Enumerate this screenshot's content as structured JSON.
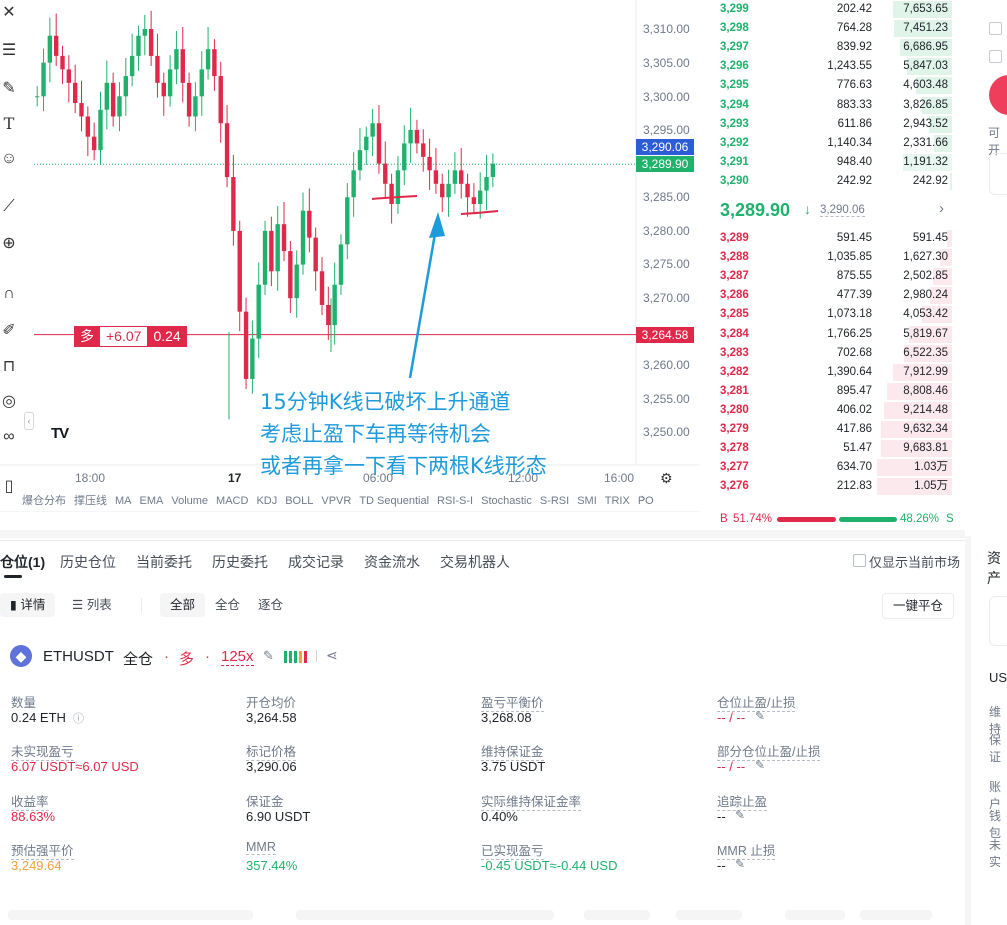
{
  "colors": {
    "up": "#20b26c",
    "down": "#e0294a",
    "annotation": "#1f9bdc",
    "price_blue": "#2c5cd6",
    "orange": "#f0a23b"
  },
  "toolbar_icons": [
    "crosshair-icon",
    "line-tool-icon",
    "brush-icon",
    "text-icon",
    "emoji-icon",
    "ruler-icon",
    "zoom-in-icon",
    "magnet-icon",
    "lock-edit-icon",
    "lock-icon",
    "eye-icon",
    "link-icon",
    "trash-icon"
  ],
  "chart": {
    "y_ticks": [
      "3,310.00",
      "3,305.00",
      "3,300.00",
      "3,295.00",
      "3,285.00",
      "3,280.00",
      "3,275.00",
      "3,270.00",
      "3,260.00",
      "3,255.00",
      "3,250.00"
    ],
    "x_ticks": [
      "18:00",
      "17",
      "06:00",
      "12:00",
      "16:00"
    ],
    "price_marks": {
      "mark": "3,290.06",
      "last": "3,289.90",
      "entry": "3,264.58"
    },
    "position_tag": {
      "side": "多",
      "pnl": "+6.07",
      "qty": "0.24"
    },
    "logo": "TV",
    "annotation": [
      "15分钟K线已破坏上升通道",
      "考虑止盈下车再等待机会",
      "或者再拿一下看下两根K线形态"
    ],
    "indicators": [
      "爆仓分布",
      "撑压线",
      "MA",
      "EMA",
      "Volume",
      "MACD",
      "KDJ",
      "BOLL",
      "VPVR",
      "TD Sequential",
      "RSI-S-I",
      "Stochastic",
      "S-RSI",
      "SMI",
      "TRIX",
      "PO"
    ]
  },
  "orderbook": {
    "bids": [
      {
        "price": "3,299",
        "qty": "202.42",
        "total": "7,653.65",
        "depth": 0.79
      },
      {
        "price": "3,298",
        "qty": "764.28",
        "total": "7,451.23",
        "depth": 0.77
      },
      {
        "price": "3,297",
        "qty": "839.92",
        "total": "6,686.95",
        "depth": 0.69
      },
      {
        "price": "3,296",
        "qty": "1,243.55",
        "total": "5,847.03",
        "depth": 0.6
      },
      {
        "price": "3,295",
        "qty": "776.63",
        "total": "4,603.48",
        "depth": 0.48
      },
      {
        "price": "3,294",
        "qty": "883.33",
        "total": "3,826.85",
        "depth": 0.4
      },
      {
        "price": "3,293",
        "qty": "611.86",
        "total": "2,943.52",
        "depth": 0.3
      },
      {
        "price": "3,292",
        "qty": "1,140.34",
        "total": "2,331.66",
        "depth": 0.24
      },
      {
        "price": "3,291",
        "qty": "948.40",
        "total": "1,191.32",
        "depth": 0.65
      },
      {
        "price": "3,290",
        "qty": "242.92",
        "total": "242.92",
        "depth": 0.03
      }
    ],
    "mid_price": "3,289.90",
    "mid_arrow": "↓",
    "mark_price": "3,290.06",
    "asks": [
      {
        "price": "3,289",
        "qty": "591.45",
        "total": "591.45",
        "depth": 0.06
      },
      {
        "price": "3,288",
        "qty": "1,035.85",
        "total": "1,627.30",
        "depth": 0.16
      },
      {
        "price": "3,287",
        "qty": "875.55",
        "total": "2,502.85",
        "depth": 0.25
      },
      {
        "price": "3,286",
        "qty": "477.39",
        "total": "2,980.24",
        "depth": 0.29
      },
      {
        "price": "3,285",
        "qty": "1,073.18",
        "total": "4,053.42",
        "depth": 0.4
      },
      {
        "price": "3,284",
        "qty": "1,766.25",
        "total": "5,819.67",
        "depth": 0.57
      },
      {
        "price": "3,283",
        "qty": "702.68",
        "total": "6,522.35",
        "depth": 0.64
      },
      {
        "price": "3,282",
        "qty": "1,390.64",
        "total": "7,912.99",
        "depth": 0.78
      },
      {
        "price": "3,281",
        "qty": "895.47",
        "total": "8,808.46",
        "depth": 0.86
      },
      {
        "price": "3,280",
        "qty": "406.02",
        "total": "9,214.48",
        "depth": 0.9
      },
      {
        "price": "3,279",
        "qty": "417.86",
        "total": "9,632.34",
        "depth": 0.94
      },
      {
        "price": "3,278",
        "qty": "51.47",
        "total": "9,683.81",
        "depth": 0.95
      },
      {
        "price": "3,277",
        "qty": "634.70",
        "total": "1.03万",
        "depth": 1.0
      },
      {
        "price": "3,276",
        "qty": "212.83",
        "total": "1.05万",
        "depth": 1.0
      }
    ],
    "ratio": {
      "b_label": "B",
      "b_pct": "51.74%",
      "s_pct": "48.26%",
      "s_label": "S",
      "b_value": 51.74
    }
  },
  "right_cut": {
    "t1": "可开",
    "t2": "资产",
    "t3": "US",
    "t4": "维持",
    "t5": "保证",
    "t6": "账户",
    "t7": "钱包",
    "t8": "未实"
  },
  "tabs": {
    "positions": "仓位(1)",
    "history_positions": "历史仓位",
    "open_orders": "当前委托",
    "order_history": "历史委托",
    "trades": "成交记录",
    "fund_flow": "资金流水",
    "bots": "交易机器人",
    "only_current": "仅显示当前市场"
  },
  "subbar": {
    "detail": "详情",
    "list": "列表",
    "all": "全部",
    "cross": "全仓",
    "isolated": "逐仓",
    "close_all": "一键平仓"
  },
  "position": {
    "symbol": "ETHUSDT",
    "margin_mode": "全仓",
    "sep": "·",
    "side": "多",
    "leverage": "125x",
    "fields": [
      {
        "label": "数量",
        "value": "0.24 ETH",
        "color": "#1e2329"
      },
      {
        "label": "开仓均价",
        "value": "3,264.58",
        "color": "#1e2329"
      },
      {
        "label": "盈亏平衡价",
        "value": "3,268.08",
        "color": "#1e2329"
      },
      {
        "label": "仓位止盈/止损",
        "value": "-- / --",
        "color": "#e0294a"
      },
      {
        "label": "未实现盈亏",
        "value": "6.07 USDT≈6.07 USD",
        "color": "#e0294a"
      },
      {
        "label": "标记价格",
        "value": "3,290.06",
        "color": "#1e2329"
      },
      {
        "label": "维持保证金",
        "value": "3.75 USDT",
        "color": "#1e2329"
      },
      {
        "label": "部分仓位止盈/止损",
        "value": "-- / --",
        "color": "#e0294a"
      },
      {
        "label": "收益率",
        "value": "88.63%",
        "color": "#e0294a"
      },
      {
        "label": "保证金",
        "value": "6.90 USDT",
        "color": "#1e2329"
      },
      {
        "label": "实际维持保证金率",
        "value": "0.40%",
        "color": "#1e2329"
      },
      {
        "label": "追踪止盈",
        "value": "--",
        "color": "#1e2329"
      },
      {
        "label": "预估强平价",
        "value": "3,249.64",
        "color": "#f0a23b"
      },
      {
        "label": "MMR",
        "value": "357.44%",
        "color": "#20b26c"
      },
      {
        "label": "已实现盈亏",
        "value": "-0.45 USDT≈-0.44 USD",
        "color": "#20b26c"
      },
      {
        "label": "MMR 止损",
        "value": "--",
        "color": "#1e2329"
      }
    ]
  }
}
